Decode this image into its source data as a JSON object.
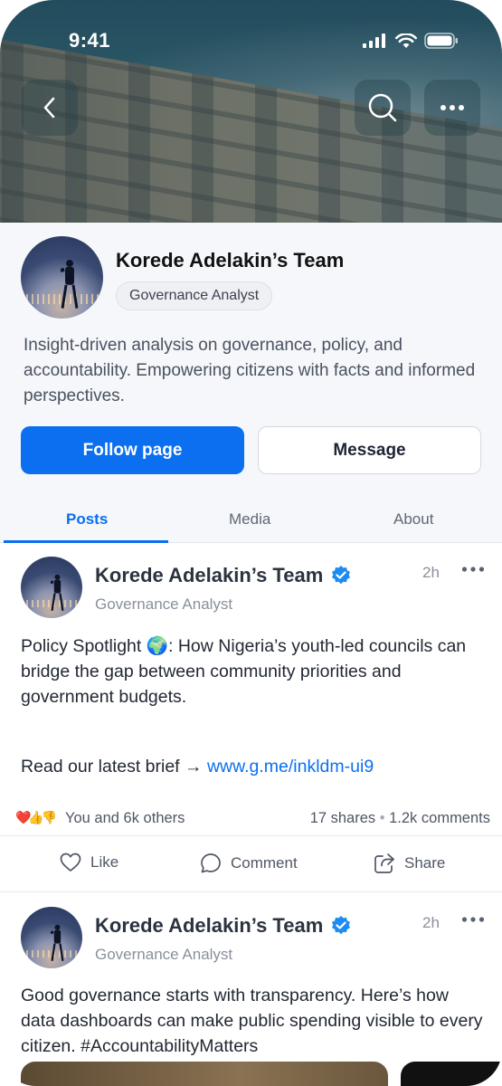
{
  "status_bar": {
    "time": "9:41"
  },
  "header": {
    "back_icon": "chevron-left-icon",
    "search_icon": "search-icon",
    "more_icon": "more-horizontal-icon"
  },
  "profile": {
    "name": "Korede Adelakin’s Team",
    "role": "Governance Analyst",
    "bio": "Insight-driven analysis on governance, policy, and accountability. Empowering citizens with facts and informed perspectives.",
    "follow_label": "Follow page",
    "message_label": "Message"
  },
  "tabs": [
    {
      "label": "Posts",
      "active": true
    },
    {
      "label": "Media",
      "active": false
    },
    {
      "label": "About",
      "active": false
    }
  ],
  "posts": [
    {
      "author": "Korede Adelakin’s Team",
      "verified": true,
      "role": "Governance Analyst",
      "time": "2h",
      "text": "Policy Spotlight 🌍: How Nigeria’s youth-led councils can bridge the gap between community priorities and government budgets.",
      "link_prefix": "Read our latest brief → ",
      "link": "www.g.me/inkldm-ui9",
      "reactions_emoji": "❤️👍👎",
      "reactions_label": "You and 6k others",
      "shares": "17 shares",
      "comments": "1.2k comments",
      "actions": {
        "like": "Like",
        "comment": "Comment",
        "share": "Share"
      }
    },
    {
      "author": "Korede Adelakin’s Team",
      "verified": true,
      "role": "Governance Analyst",
      "time": "2h",
      "text": "Good governance starts with transparency. Here’s how data dashboards can make public spending visible to every citizen. #AccountabilityMatters"
    }
  ],
  "colors": {
    "accent": "#0b6ff0",
    "verified": "#1d8cf2"
  }
}
